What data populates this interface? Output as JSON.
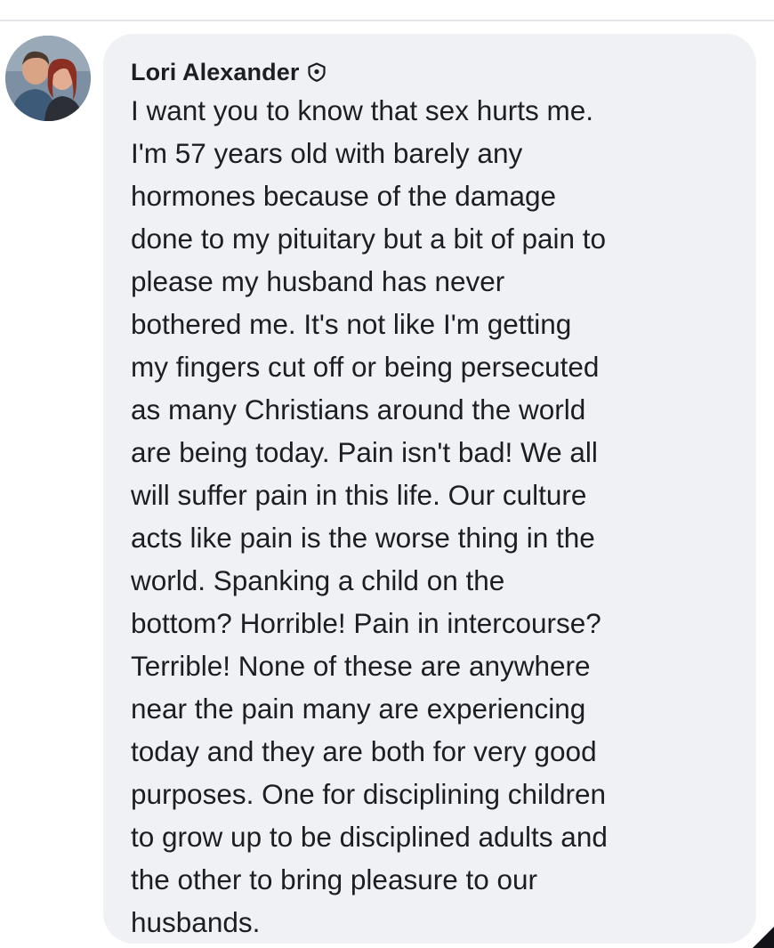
{
  "comment": {
    "author": "Lori Alexander",
    "avatar_icon": "profile-photo-avatar",
    "badge_icon": "shield-badge-icon",
    "text": "I want you to know that sex hurts me.\nI'm 57 years old with barely any\nhormones because of the damage\ndone to my pituitary but a bit of pain to\nplease my husband has never\nbothered me. It's not like I'm getting\nmy fingers cut off or being persecuted\nas many Christians around the world\nare being today. Pain isn't bad! We all\nwill suffer pain in this life. Our culture\nacts like pain is the worse thing in the\nworld. Spanking a child on the\nbottom? Horrible! Pain in intercourse?\nTerrible! None of these are anywhere\nnear the pain many are experiencing\ntoday and they are both for very good\npurposes. One for disciplining children\nto grow up to be disciplined adults and\nthe other to bring pleasure to our\nhusbands."
  },
  "colors": {
    "bubble_background": "#eff1f4",
    "text": "#1c1e21",
    "divider": "#e4e6ea"
  }
}
